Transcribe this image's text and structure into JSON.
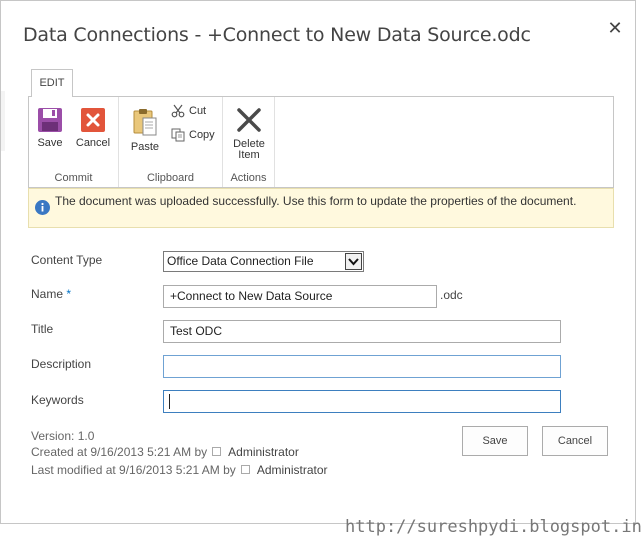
{
  "dialog": {
    "title": "Data Connections - +Connect to New Data Source.odc",
    "close_glyph": "✕"
  },
  "ribbon": {
    "tab_label": "EDIT",
    "groups": {
      "commit": {
        "label": "Commit",
        "save_label": "Save",
        "cancel_label": "Cancel"
      },
      "clipboard": {
        "label": "Clipboard",
        "paste_label": "Paste",
        "cut_label": "Cut",
        "copy_label": "Copy"
      },
      "actions": {
        "label": "Actions",
        "delete_label_line1": "Delete",
        "delete_label_line2": "Item"
      }
    },
    "icons": {
      "save": "save-icon",
      "cancel": "cancel-icon",
      "paste": "paste-icon",
      "cut": "scissors-icon",
      "copy": "copy-icon",
      "delete": "delete-icon"
    }
  },
  "notice": {
    "icon": "info-icon",
    "text": "The document was uploaded successfully. Use this form to update the properties of the document."
  },
  "form": {
    "content_type": {
      "label": "Content Type",
      "value": "Office Data Connection File"
    },
    "name": {
      "label": "Name",
      "required_marker": "*",
      "value": "+Connect to New Data Source",
      "suffix": ".odc"
    },
    "title": {
      "label": "Title",
      "value": "Test ODC"
    },
    "description": {
      "label": "Description",
      "value": ""
    },
    "keywords": {
      "label": "Keywords",
      "value": ""
    }
  },
  "meta": {
    "version": "Version: 1.0",
    "created_prefix": "Created at 9/16/2013 5:21 AM  by",
    "created_by": "Administrator",
    "modified_prefix": "Last modified at 9/16/2013 5:21 AM  by",
    "modified_by": "Administrator"
  },
  "buttons": {
    "save": "Save",
    "cancel": "Cancel"
  },
  "watermark": "http://sureshpydi.blogspot.in/",
  "colors": {
    "accent": "#0072c6",
    "save_purple": "#9b4ea8",
    "cancel_red": "#e2553b",
    "notice_bg": "#fff9de",
    "info_blue": "#3a78c3"
  }
}
